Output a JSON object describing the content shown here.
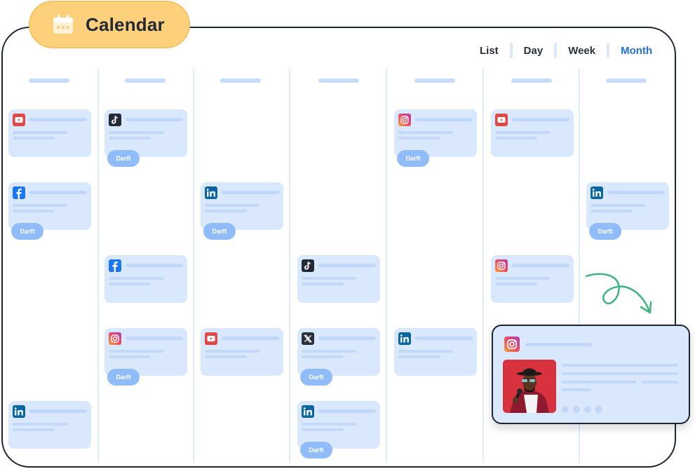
{
  "header": {
    "title": "Calendar",
    "title_icon": "calendar-icon"
  },
  "view_tabs": [
    {
      "label": "List",
      "active": false
    },
    {
      "label": "Day",
      "active": false
    },
    {
      "label": "Week",
      "active": false
    },
    {
      "label": "Month",
      "active": true
    }
  ],
  "colors": {
    "accent": "#1f6fd6",
    "title_pill": "#fdd07b",
    "card_bg": "#d9e8fd",
    "draft_badge": "#90bdfa",
    "arrow": "#3db57e"
  },
  "columns": [
    {
      "posts": [
        {
          "platform": "youtube",
          "icon": "youtube-icon",
          "slot": 0,
          "status": ""
        },
        {
          "platform": "facebook",
          "icon": "facebook-icon",
          "slot": 1,
          "status": "Darft"
        },
        {
          "platform": "linkedin",
          "icon": "linkedin-icon",
          "slot": 4,
          "status": ""
        }
      ]
    },
    {
      "posts": [
        {
          "platform": "tiktok",
          "icon": "tiktok-icon",
          "slot": 0,
          "status": "Darft"
        },
        {
          "platform": "facebook",
          "icon": "facebook-icon",
          "slot": 2,
          "status": ""
        },
        {
          "platform": "instagram",
          "icon": "instagram-icon",
          "slot": 3,
          "status": "Darft"
        }
      ]
    },
    {
      "posts": [
        {
          "platform": "linkedin",
          "icon": "linkedin-icon",
          "slot": 1,
          "status": "Darft"
        },
        {
          "platform": "youtube",
          "icon": "youtube-icon",
          "slot": 3,
          "status": ""
        }
      ]
    },
    {
      "posts": [
        {
          "platform": "tiktok",
          "icon": "tiktok-icon",
          "slot": 2,
          "status": ""
        },
        {
          "platform": "x",
          "icon": "x-icon",
          "slot": 3,
          "status": "Darft"
        },
        {
          "platform": "linkedin",
          "icon": "linkedin-icon",
          "slot": 4,
          "status": "Darft"
        }
      ]
    },
    {
      "posts": [
        {
          "platform": "instagram",
          "icon": "instagram-icon",
          "slot": 0,
          "status": "Darft"
        },
        {
          "platform": "linkedin",
          "icon": "linkedin-icon",
          "slot": 3,
          "status": ""
        }
      ]
    },
    {
      "posts": [
        {
          "platform": "youtube",
          "icon": "youtube-icon",
          "slot": 0,
          "status": ""
        },
        {
          "platform": "instagram",
          "icon": "instagram-icon",
          "slot": 2,
          "status": ""
        }
      ]
    },
    {
      "posts": [
        {
          "platform": "linkedin",
          "icon": "linkedin-icon",
          "slot": 1,
          "status": "Darft"
        }
      ]
    }
  ],
  "featured_post": {
    "platform": "instagram",
    "icon": "instagram-icon",
    "image": "singer-with-microphone-photo",
    "carousel_dots": 4
  }
}
